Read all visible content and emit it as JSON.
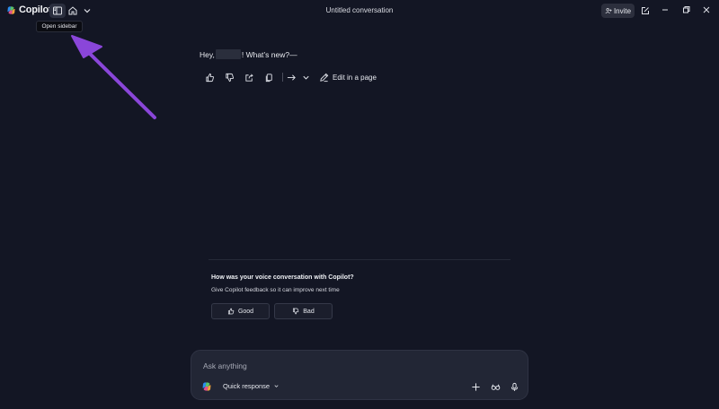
{
  "app": {
    "name": "Copilot",
    "window_title": "Untitled conversation"
  },
  "titlebar": {
    "invite_label": "Invite",
    "tooltip": "Open sidebar"
  },
  "conversation": {
    "greeting_prefix": "Hey,",
    "greeting_suffix": "! What’s new?—",
    "edit_in_page_label": "Edit in a page"
  },
  "feedback": {
    "title": "How was your voice conversation with Copilot?",
    "subtitle": "Give Copilot feedback so it can improve next time",
    "good_label": "Good",
    "bad_label": "Bad"
  },
  "composer": {
    "placeholder": "Ask anything",
    "mode_label": "Quick response"
  },
  "colors": {
    "background": "#131624",
    "composer": "#222635",
    "annotation_arrow": "#8a46d9"
  },
  "icons": [
    "copilot-logo",
    "sidebar-icon",
    "home-icon",
    "chevron-down-icon",
    "invite-icon",
    "new-chat-icon",
    "minimize-icon",
    "maximize-icon",
    "close-icon",
    "thumbs-up-icon",
    "thumbs-down-icon",
    "share-icon",
    "copy-icon",
    "export-icon",
    "edit-page-icon",
    "plus-icon",
    "vision-icon",
    "mic-icon"
  ]
}
